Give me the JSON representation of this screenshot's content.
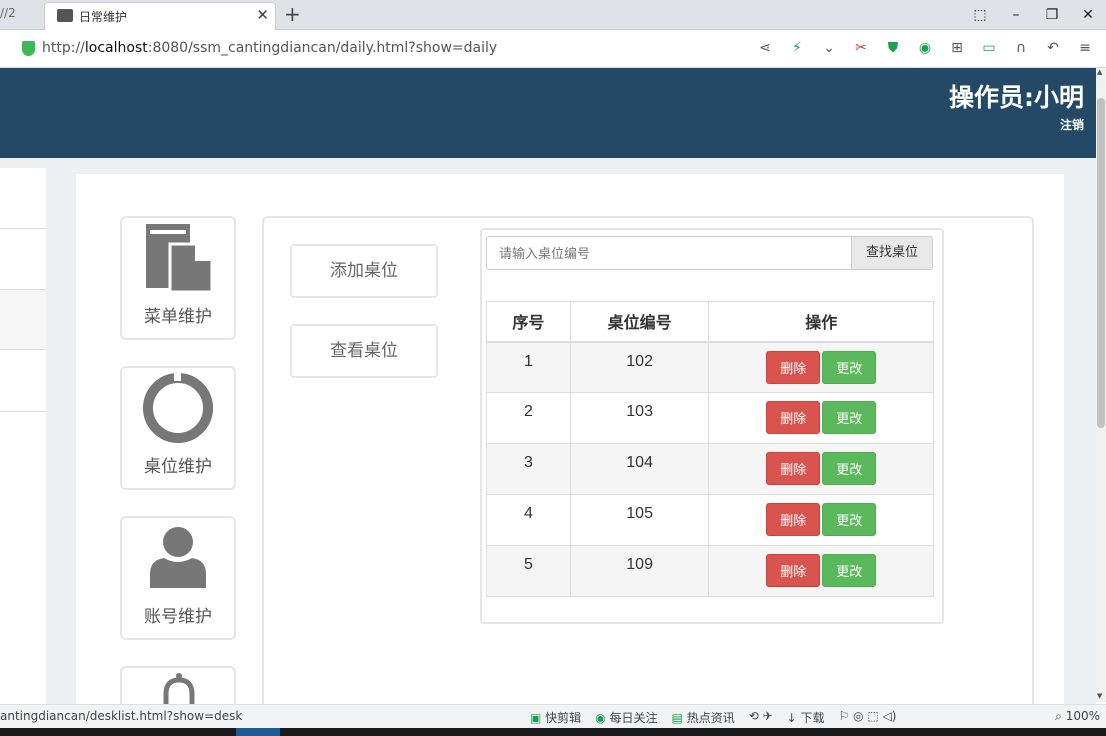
{
  "browser": {
    "prev_tab_text": "//2",
    "tab_title": "日常维护",
    "url_prefix": "http://",
    "url_host": "localhost",
    "url_rest": ":8080/ssm_cantingdiancan/daily.html?show=daily",
    "window_buttons": [
      "⬚",
      "–",
      "❐",
      "✕"
    ]
  },
  "header": {
    "operator": "操作员:小明",
    "logout": "注销"
  },
  "sidebar": {
    "items": [
      {
        "label": "菜单维护",
        "icon": "document-copy-icon"
      },
      {
        "label": "桌位维护",
        "icon": "ring-icon"
      },
      {
        "label": "账号维护",
        "icon": "user-icon"
      },
      {
        "label": "",
        "icon": "bell-icon"
      }
    ]
  },
  "actions": {
    "add_desk": "添加桌位",
    "view_desk": "查看桌位"
  },
  "search": {
    "placeholder": "请输入桌位编号",
    "value": "",
    "button": "查找桌位"
  },
  "table": {
    "headers": [
      "序号",
      "桌位编号",
      "操作"
    ],
    "rows": [
      {
        "index": "1",
        "number": "102"
      },
      {
        "index": "2",
        "number": "103"
      },
      {
        "index": "3",
        "number": "104"
      },
      {
        "index": "4",
        "number": "105"
      },
      {
        "index": "5",
        "number": "109"
      }
    ],
    "delete_label": "删除",
    "edit_label": "更改"
  },
  "statusbar": {
    "hover_url": "antingdiancan/desklist.html?show=desk",
    "items": [
      "快剪辑",
      "每日关注",
      "热点资讯",
      "下载"
    ],
    "zoom": "100%"
  }
}
